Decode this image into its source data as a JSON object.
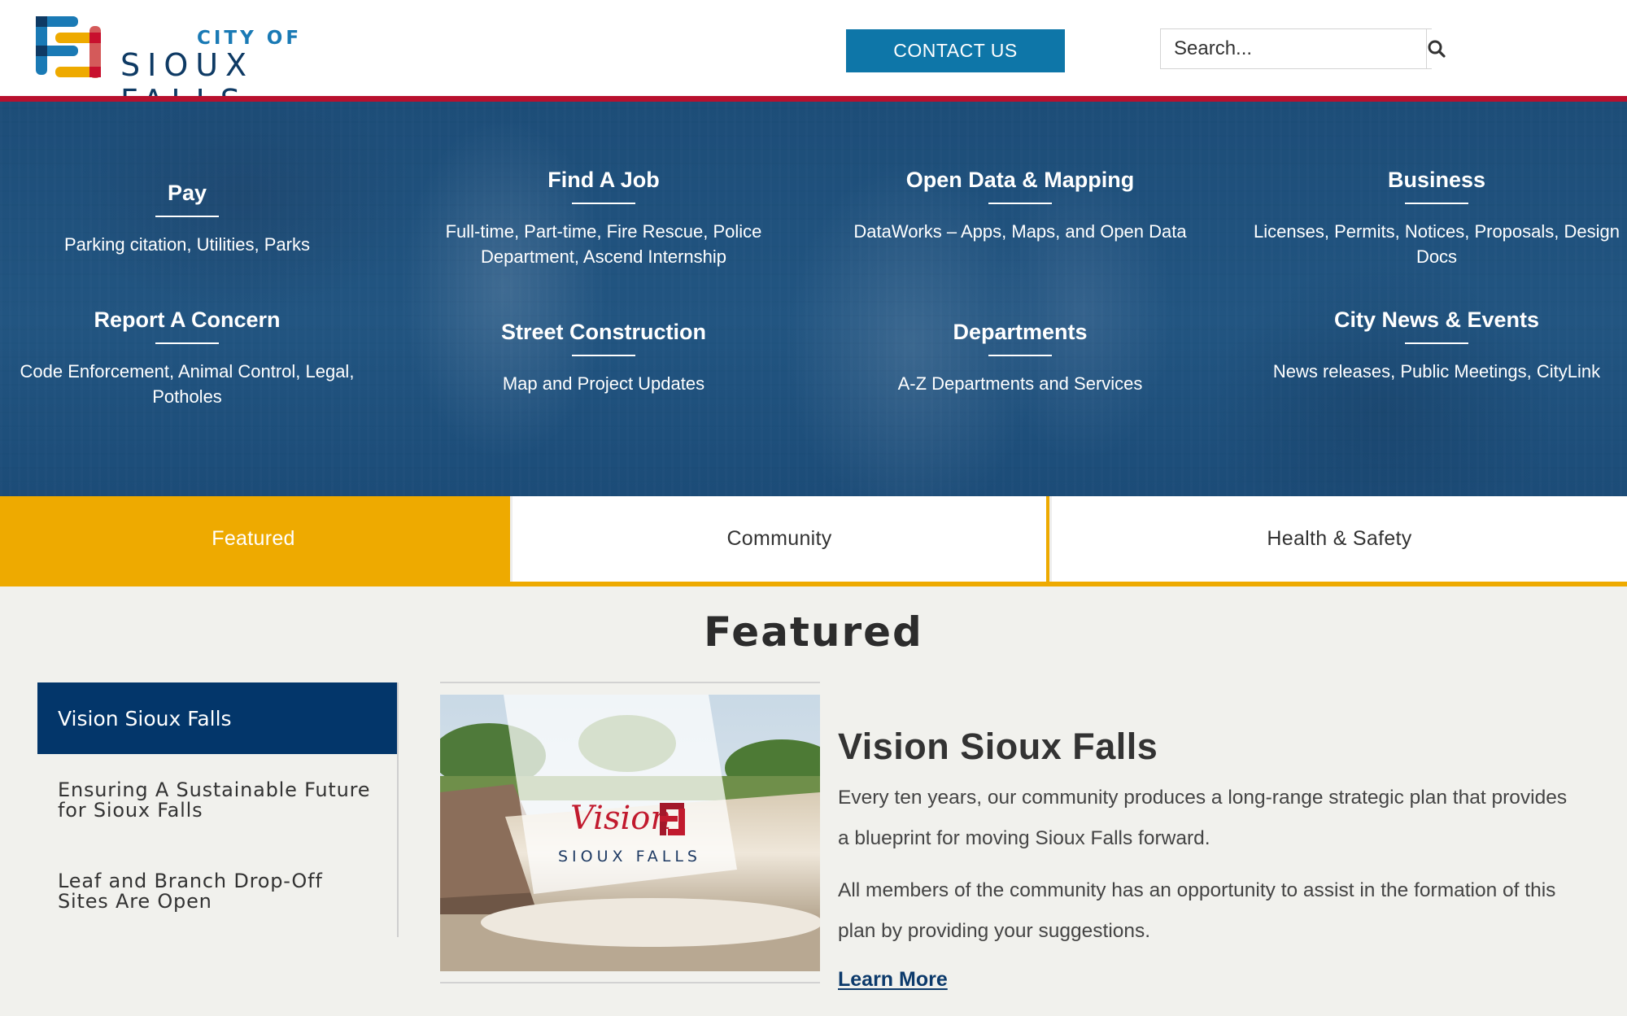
{
  "header": {
    "logo": {
      "line1": "CITY OF",
      "line2": "SIOUX FALLS",
      "icon": "city-logo-mark-icon"
    },
    "contact_label": "CONTACT US",
    "search": {
      "placeholder": "Search...",
      "icon": "search-icon"
    }
  },
  "quick_links": [
    {
      "title": "Pay",
      "desc": "Parking citation, Utilities, Parks"
    },
    {
      "title": "Find A Job",
      "desc": "Full-time, Part-time, Fire Rescue, Police Department, Ascend Internship"
    },
    {
      "title": "Open Data & Mapping",
      "desc": "DataWorks – Apps, Maps, and Open Data"
    },
    {
      "title": "Business",
      "desc": "Licenses, Permits, Notices, Proposals, Design Docs"
    },
    {
      "title": "Report A Concern",
      "desc": "Code Enforcement, Animal Control, Legal, Potholes"
    },
    {
      "title": "Street Construction",
      "desc": "Map and Project Updates"
    },
    {
      "title": "Departments",
      "desc": "A-Z Departments and Services"
    },
    {
      "title": "City News & Events",
      "desc": "News releases, Public Meetings, CityLink"
    }
  ],
  "tabs": [
    {
      "label": "Featured",
      "active": true
    },
    {
      "label": "Community",
      "active": false
    },
    {
      "label": "Health & Safety",
      "active": false
    }
  ],
  "featured": {
    "heading": "Featured",
    "sidebar": [
      {
        "label": "Vision Sioux Falls",
        "active": true
      },
      {
        "label": "Ensuring A Sustainable Future for Sioux Falls",
        "active": false
      },
      {
        "label": "Leaf and Branch Drop-Off Sites Are Open",
        "active": false
      }
    ],
    "image": {
      "logo_script": "Vision",
      "logo_name": "SIOUX FALLS"
    },
    "article": {
      "title": "Vision Sioux Falls",
      "paragraphs": [
        "Every ten years, our community produces a long-range strategic plan that provides a blueprint for moving Sioux Falls forward.",
        "All members of the community has an opportunity to assist in the formation of this plan by providing your suggestions."
      ],
      "link_label": "Learn More"
    }
  },
  "colors": {
    "brand_blue": "#0e76a8",
    "navy": "#03366a",
    "accent_red": "#b8102e",
    "accent_gold": "#eeaa00",
    "page_bg": "#f1f1ed"
  }
}
